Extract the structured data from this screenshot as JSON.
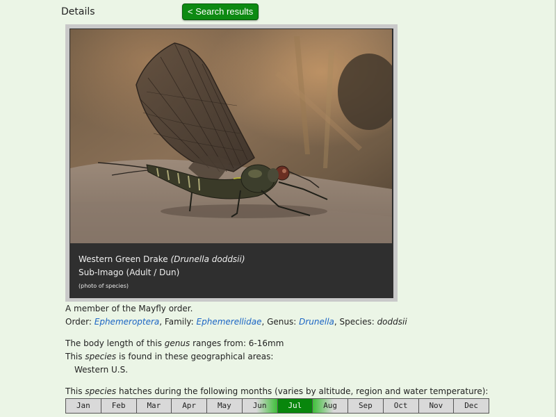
{
  "header": {
    "title": "Details",
    "back_button": "< Search results"
  },
  "photo": {
    "common_name": "Western Green Drake",
    "scientific_name": "(Drunella doddsii)",
    "stage": "Sub-Imago (Adult / Dun)",
    "note": "(photo of species)"
  },
  "info": {
    "member_of": "A member of the Mayfly order.",
    "order_label": "Order: ",
    "order": "Ephemeroptera",
    "family_label": ", Family: ",
    "family": "Ephemerellidae",
    "genus_label": ", Genus: ",
    "genus": "Drunella",
    "species_label": ", Species: ",
    "species": "doddsii",
    "length_prefix": "The body length of this ",
    "length_genus_word": "genus",
    "length_suffix": " ranges from: 6-16mm",
    "areas_prefix": "This ",
    "areas_species_word": "species",
    "areas_suffix": " is found in these geographical areas:",
    "area_1": "Western U.S.",
    "hatch_prefix": "This ",
    "hatch_species_word": "species",
    "hatch_suffix": " hatches during the following months (varies by altitude, region and water temperature):"
  },
  "months": [
    {
      "label": "Jan",
      "level": 0
    },
    {
      "label": "Feb",
      "level": 0
    },
    {
      "label": "Mar",
      "level": 0
    },
    {
      "label": "Apr",
      "level": 0
    },
    {
      "label": "May",
      "level": 0
    },
    {
      "label": "Jun",
      "level": 0.5
    },
    {
      "label": "Jul",
      "level": 1
    },
    {
      "label": "Aug",
      "level": 0.5
    },
    {
      "label": "Sep",
      "level": 0
    },
    {
      "label": "Oct",
      "level": 0
    },
    {
      "label": "Nov",
      "level": 0
    },
    {
      "label": "Dec",
      "level": 0
    }
  ],
  "colors": {
    "button": "#0d8a12",
    "link": "#1a64c4",
    "hatch_peak": "#08860c"
  }
}
